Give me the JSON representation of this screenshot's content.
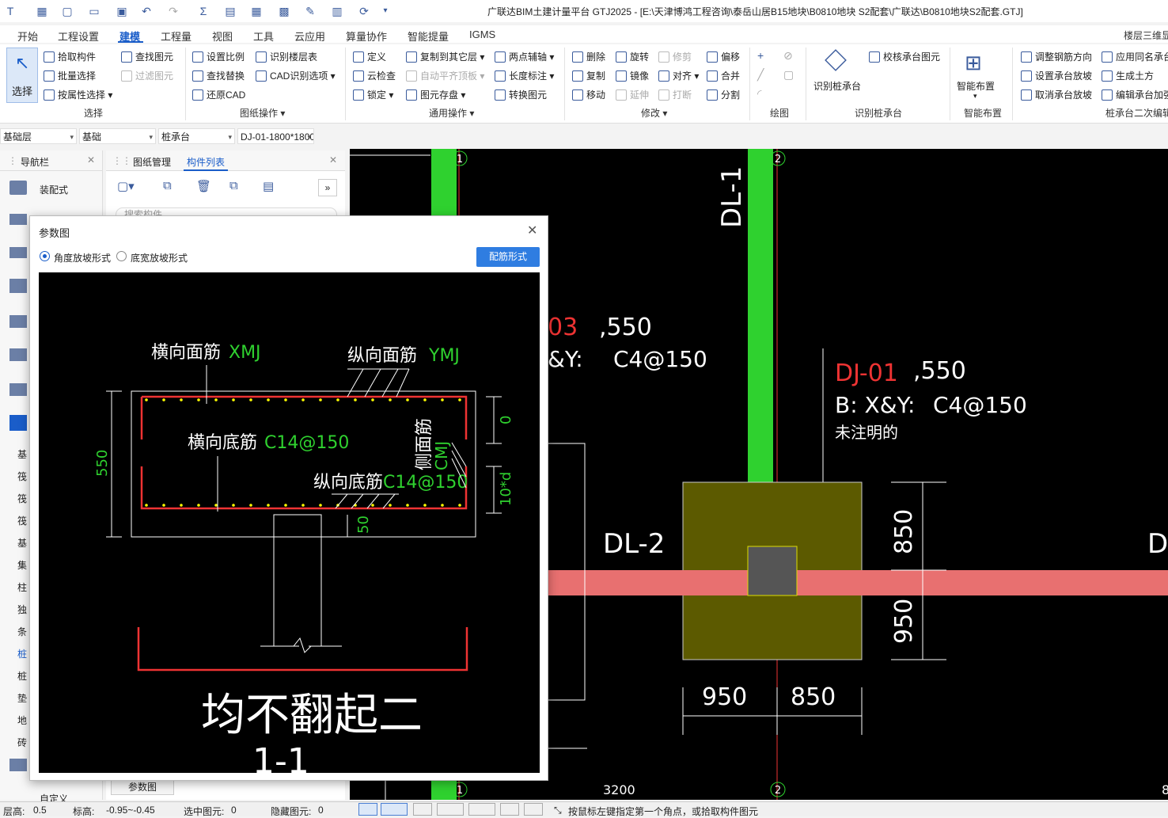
{
  "app": {
    "title": "广联达BIM土建计量平台 GTJ2025 - [E:\\天津博鸿工程咨询\\泰岳山居B15地块\\B0810地块 S2配套\\广联达\\B0810地块S2配套.GTJ]"
  },
  "menu": [
    "开始",
    "工程设置",
    "建模",
    "工程量",
    "视图",
    "工具",
    "云应用",
    "算量协作",
    "智能提量",
    "IGMS"
  ],
  "menu_active": "建模",
  "menu_right": "楼层三维显",
  "ribbon": {
    "select": {
      "label": "选择",
      "group": "选择"
    },
    "pick": "拾取构件",
    "batch": "批量选择",
    "by_prop": "按属性选择",
    "find": "查找图元",
    "filter": "过滤图元",
    "set_scale": "设置比例",
    "find_replace": "查找替换",
    "restore_cad": "还原CAD",
    "floor_table": "识别楼层表",
    "cad_opt": "CAD识别选项",
    "grp_drawing": "图纸操作",
    "define": "定义",
    "cloud_check": "云检查",
    "lock": "锁定",
    "copy_floor": "复制到其它层",
    "auto_align": "自动平齐顶板",
    "save_elem": "图元存盘",
    "two_axis": "两点辅轴",
    "length_dim": "长度标注",
    "convert": "转换图元",
    "grp_common": "通用操作",
    "delete": "删除",
    "copy": "复制",
    "move": "移动",
    "rotate": "旋转",
    "mirror": "镜像",
    "extend": "延伸",
    "trim": "修剪",
    "align": "对齐",
    "break": "打断",
    "offset": "偏移",
    "merge": "合并",
    "split": "分割",
    "grp_modify": "修改",
    "grp_draw": "绘图",
    "recog_cap": "识别桩承台",
    "check_cap": "校核承台图元",
    "grp_recog": "识别桩承台",
    "smart_layout": "智能布置",
    "grp_smart": "智能布置",
    "adj_rebar": "调整钢筋方向",
    "set_slope": "设置承台放坡",
    "cancel_slope": "取消承台放坡",
    "apply_same": "应用同名承台",
    "gen_earth": "生成土方",
    "edit_rebar": "编辑承台加强",
    "grp_cap2": "桩承台二次编辑"
  },
  "selectors": [
    "基础层",
    "基础",
    "桩承台",
    "DJ-01-1800*1800"
  ],
  "nav": {
    "title": "导航栏",
    "assembly": "装配式",
    "items": [
      "基",
      "筏",
      "筏",
      "筏",
      "基",
      "集",
      "柱",
      "独",
      "条",
      "桩",
      "桩",
      "垫",
      "地",
      "砖"
    ],
    "custom": "自定义"
  },
  "comp": {
    "tab1": "图纸管理",
    "tab2": "构件列表",
    "search_placeholder": "搜索构件...",
    "param_btn": "参数图"
  },
  "dialog": {
    "title": "参数图",
    "radio1": "角度放坡形式",
    "radio2": "底宽放坡形式",
    "btn": "配筋形式",
    "drawing": {
      "xmj": "横向面筋",
      "xmj_code": "XMJ",
      "ymj": "纵向面筋",
      "ymj_code": "YMJ",
      "xdj": "横向底筋",
      "xdj_val": "C14@150",
      "ydj": "纵向底筋",
      "ydj_val": "C14@150",
      "side": "侧面筋",
      "side_code": "CMJ",
      "h550": "550",
      "top0": "0",
      "d10": "10*d",
      "b50": "50",
      "big1": "均不翻起二",
      "big2": "1-1"
    }
  },
  "cad": {
    "axis1": "1",
    "axis2": "2",
    "dl1": "DL-1",
    "dl2": "DL-2",
    "dl_right": "DL",
    "dj01": "DJ-01",
    "h550": ",550",
    "b_xy": "B: X&Y:",
    "bar": "C4@150",
    "left03": "03",
    "left550": ",550",
    "leftxy": "&Y:",
    "leftbar": "C4@150",
    "note": "未注明的",
    "d850": "850",
    "d950": "950",
    "w950": "950",
    "w850": "850",
    "len3200": "3200",
    "right8": "8"
  },
  "status": {
    "floor_h": "层高:",
    "floor_h_v": "0.5",
    "elev": "标高:",
    "elev_v": "-0.95~-0.45",
    "sel": "选中图元:",
    "sel_v": "0",
    "hid": "隐藏图元:",
    "hid_v": "0",
    "hint": "按鼠标左键指定第一个角点，或拾取构件图元"
  },
  "colors": {
    "accent": "#1a5dc9",
    "beam": "#e87070",
    "column": "#2fd12f",
    "cap": "#5c5a00"
  }
}
